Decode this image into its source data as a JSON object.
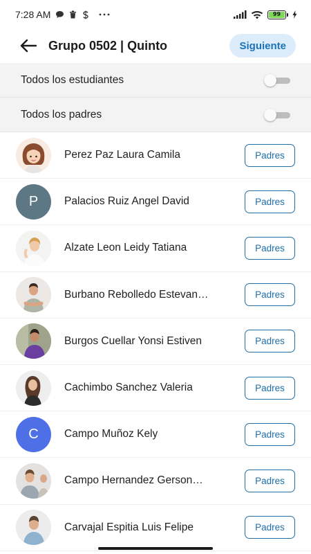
{
  "status_bar": {
    "time": "7:28 AM",
    "battery": "99",
    "icons": [
      "chat-bubble-icon",
      "trash-icon",
      "s-app-icon",
      "more-dots-icon",
      "signal-icon",
      "wifi-icon",
      "battery-icon",
      "charging-icon"
    ]
  },
  "header": {
    "title": "Grupo 0502 | Quinto",
    "next_label": "Siguiente",
    "back_icon": "arrow-left-icon"
  },
  "toggles": [
    {
      "label": "Todos los estudiantes",
      "on": false
    },
    {
      "label": "Todos los padres",
      "on": false
    }
  ],
  "students": [
    {
      "name": "Perez Paz Laura  Camila",
      "avatar": "photo",
      "button": "Padres"
    },
    {
      "name": "Palacios  Ruiz Angel  David",
      "avatar": "initial",
      "initial": "P",
      "avatar_color": "#5d7785",
      "button": "Padres"
    },
    {
      "name": "Alzate Leon Leidy Tatiana",
      "avatar": "photo",
      "button": "Padres"
    },
    {
      "name": "Burbano Rebolledo Estevan Fernando",
      "display": "Burbano Rebolledo Estevan…",
      "avatar": "photo",
      "button": "Padres"
    },
    {
      "name": "Burgos Cuellar Yonsi Estiven",
      "avatar": "photo",
      "button": "Padres"
    },
    {
      "name": "Cachimbo Sanchez Valeria",
      "avatar": "photo",
      "button": "Padres"
    },
    {
      "name": "Campo Muñoz Kely",
      "avatar": "initial",
      "initial": "C",
      "avatar_color": "#4f6fe6",
      "button": "Padres"
    },
    {
      "name": "Campo  Hernandez Gerson…",
      "avatar": "photo",
      "button": "Padres"
    },
    {
      "name": "Carvajal Espitia Luis Felipe",
      "avatar": "photo",
      "button": "Padres"
    }
  ],
  "colors": {
    "accent": "#1e6fa8",
    "next_bg": "#dcecfa",
    "toggle_bg": "#f3f3f3"
  }
}
